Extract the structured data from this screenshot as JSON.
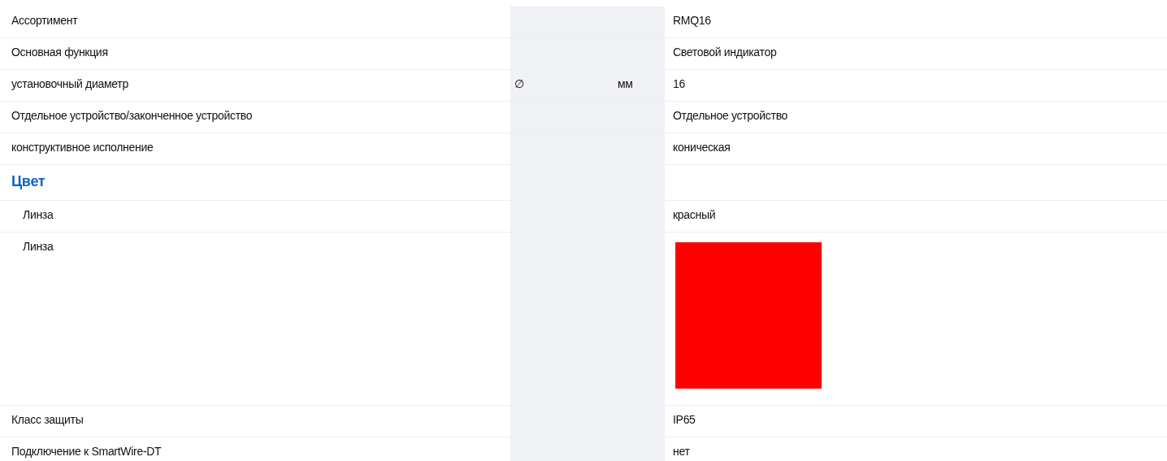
{
  "rows": [
    {
      "kind": "row",
      "label": "Ассортимент",
      "value": "RMQ16"
    },
    {
      "kind": "row",
      "label": "Основная функция",
      "value": "Световой индикатор"
    },
    {
      "kind": "row",
      "label": "установочный диаметр",
      "symbol": "∅",
      "unit": "мм",
      "value": "16"
    },
    {
      "kind": "row",
      "label": "Отдельное устройство/законченное устройство",
      "value": "Отдельное устройство"
    },
    {
      "kind": "row",
      "label": "конструктивное исполнение",
      "value": "коническая"
    },
    {
      "kind": "heading",
      "label": "Цвет",
      "children": [
        {
          "kind": "row",
          "label": "Линза",
          "value": "красный"
        },
        {
          "kind": "swatch",
          "label": "Линза",
          "color": "#ff0000"
        }
      ]
    },
    {
      "kind": "row",
      "label": "Класс защиты",
      "value": "IP65"
    },
    {
      "kind": "row",
      "label": "Подключение к SmartWire-DT",
      "value": "нет"
    }
  ]
}
